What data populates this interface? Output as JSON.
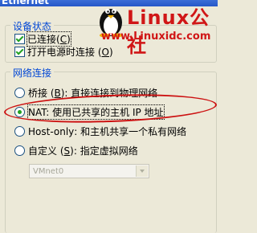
{
  "window": {
    "title": "Ethernet"
  },
  "watermark": {
    "brand": "Linux公社",
    "url": "www.Linuxidc.com"
  },
  "device_status": {
    "legend": "设备状态",
    "connected_label": "已连接",
    "connected_key": "C",
    "connected_checked": true,
    "connect_on_power_label": "打开电源时连接",
    "connect_on_power_key": "O",
    "connect_on_power_checked": true
  },
  "network_connection": {
    "legend": "网络连接",
    "options": [
      {
        "label": "桥接",
        "key": "B",
        "desc": "直接连接到物理网络",
        "selected": false
      },
      {
        "label": "NAT",
        "key": "",
        "desc": "使用已共享的主机 IP 地址",
        "selected": true
      },
      {
        "label": "Host-only",
        "key": "H",
        "desc": "和主机共享一个私有网络",
        "selected": false
      },
      {
        "label": "自定义",
        "key": "S",
        "desc": "指定虚拟网络",
        "selected": false
      }
    ],
    "vmnet_select": "VMnet0"
  },
  "colors": {
    "annotation": "#cc1111",
    "legend": "#0046d5",
    "check": "#21a121"
  }
}
